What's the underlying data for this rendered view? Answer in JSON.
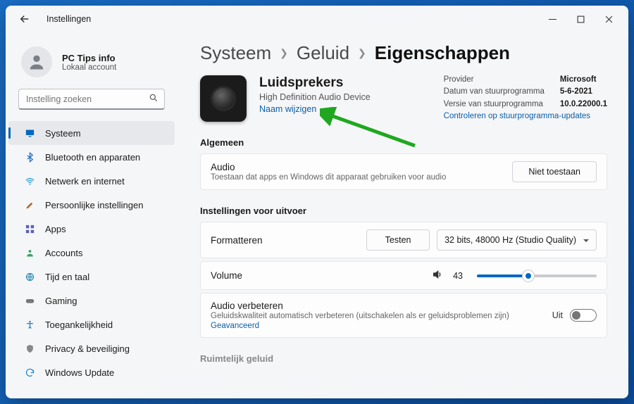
{
  "titlebar": {
    "app_title": "Instellingen"
  },
  "user": {
    "name": "PC Tips info",
    "sub": "Lokaal account"
  },
  "search": {
    "placeholder": "Instelling zoeken"
  },
  "nav": [
    {
      "label": "Systeem",
      "active": true,
      "icon": "monitor"
    },
    {
      "label": "Bluetooth en apparaten",
      "active": false,
      "icon": "bluetooth"
    },
    {
      "label": "Netwerk en internet",
      "active": false,
      "icon": "wifi"
    },
    {
      "label": "Persoonlijke instellingen",
      "active": false,
      "icon": "brush"
    },
    {
      "label": "Apps",
      "active": false,
      "icon": "apps"
    },
    {
      "label": "Accounts",
      "active": false,
      "icon": "person"
    },
    {
      "label": "Tijd en taal",
      "active": false,
      "icon": "globe"
    },
    {
      "label": "Gaming",
      "active": false,
      "icon": "game"
    },
    {
      "label": "Toegankelijkheid",
      "active": false,
      "icon": "access"
    },
    {
      "label": "Privacy & beveiliging",
      "active": false,
      "icon": "shield"
    },
    {
      "label": "Windows Update",
      "active": false,
      "icon": "update"
    }
  ],
  "breadcrumb": [
    {
      "label": "Systeem",
      "strong": false
    },
    {
      "label": "Geluid",
      "strong": false
    },
    {
      "label": "Eigenschappen",
      "strong": true
    }
  ],
  "device": {
    "title": "Luidsprekers",
    "sub": "High Definition Audio Device",
    "rename": "Naam wijzigen",
    "provider_label": "Provider",
    "provider_value": "Microsoft",
    "driver_date_label": "Datum van stuurprogramma",
    "driver_date_value": "5-6-2021",
    "driver_version_label": "Versie van stuurprogramma",
    "driver_version_value": "10.0.22000.1",
    "check_updates": "Controleren op stuurprogramma-updates"
  },
  "sections": {
    "general": "Algemeen",
    "output": "Instellingen voor uitvoer",
    "spatial": "Ruimtelijk geluid"
  },
  "audio_card": {
    "title": "Audio",
    "sub": "Toestaan dat apps en Windows dit apparaat gebruiken voor audio",
    "button": "Niet toestaan"
  },
  "format_card": {
    "title": "Formatteren",
    "test_button": "Testen",
    "dropdown": "32 bits, 48000 Hz (Studio Quality)"
  },
  "volume_card": {
    "title": "Volume",
    "value": "43"
  },
  "enhance_card": {
    "title": "Audio verbeteren",
    "sub": "Geluidskwaliteit automatisch verbeteren (uitschakelen als er geluidsproblemen zijn)",
    "advanced": "Geavanceerd",
    "toggle_label": "Uit"
  }
}
